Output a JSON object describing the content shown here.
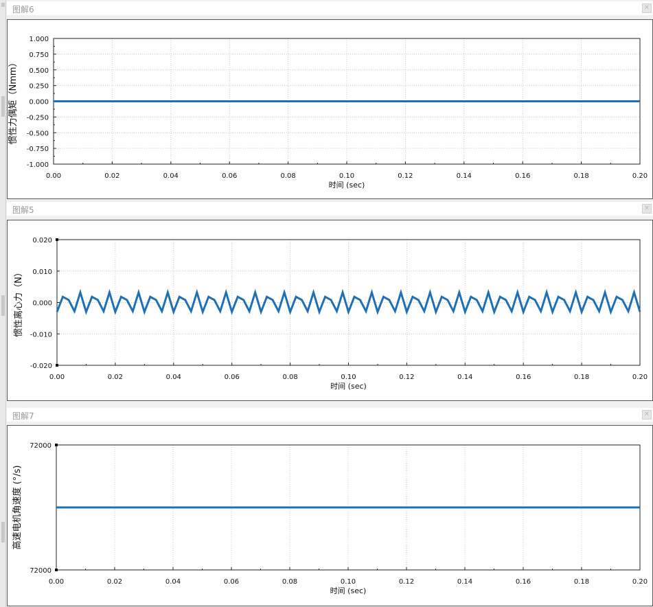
{
  "panels": [
    {
      "title": "图解6",
      "close_icon": "close-icon"
    },
    {
      "title": "图解5",
      "close_icon": "close-icon"
    },
    {
      "title": "图解7",
      "close_icon": "close-icon"
    }
  ],
  "chart_data": [
    {
      "type": "line",
      "title": "",
      "xlabel": "时间 (sec)",
      "ylabel": "惯性力偶矩（Nmm）",
      "xlim": [
        0,
        0.2
      ],
      "ylim": [
        -1.0,
        1.0
      ],
      "xticks": [
        "0.00",
        "0.02",
        "0.04",
        "0.06",
        "0.08",
        "0.10",
        "0.12",
        "0.14",
        "0.16",
        "0.18",
        "0.20"
      ],
      "yticks": [
        "1.000",
        "0.750",
        "0.500",
        "0.250",
        "0.000",
        "-0.250",
        "-0.500",
        "-0.750",
        "-1.000"
      ],
      "grid": true,
      "color": "#1f6fb5",
      "series": [
        {
          "x": [
            0,
            0.2
          ],
          "y": [
            0,
            0
          ]
        }
      ]
    },
    {
      "type": "line",
      "title": "",
      "xlabel": "时间 (sec)",
      "ylabel": "惯性离心力（N）",
      "xlim": [
        0,
        0.2
      ],
      "ylim": [
        -0.02,
        0.02
      ],
      "xticks": [
        "0.00",
        "0.02",
        "0.04",
        "0.06",
        "0.08",
        "0.10",
        "0.12",
        "0.14",
        "0.16",
        "0.18",
        "0.20"
      ],
      "yticks": [
        "0.020",
        "0.010",
        "0.000",
        "-0.010",
        "-0.020"
      ],
      "grid": true,
      "color": "#1f6fb5",
      "series": [
        {
          "x": [
            0,
            0.002,
            0.004,
            0.006,
            0.008,
            0.01,
            0.012,
            0.014,
            0.016,
            0.018,
            0.02,
            0.022,
            0.024,
            0.026,
            0.028,
            0.03,
            0.032,
            0.034,
            0.036,
            0.038,
            0.04,
            0.042,
            0.044,
            0.046,
            0.048,
            0.05,
            0.052,
            0.054,
            0.056,
            0.058,
            0.06,
            0.062,
            0.064,
            0.066,
            0.068,
            0.07,
            0.072,
            0.074,
            0.076,
            0.078,
            0.08,
            0.082,
            0.084,
            0.086,
            0.088,
            0.09,
            0.092,
            0.094,
            0.096,
            0.098,
            0.1,
            0.102,
            0.104,
            0.106,
            0.108,
            0.11,
            0.112,
            0.114,
            0.116,
            0.118,
            0.12,
            0.122,
            0.124,
            0.126,
            0.128,
            0.13,
            0.132,
            0.134,
            0.136,
            0.138,
            0.14,
            0.142,
            0.144,
            0.146,
            0.148,
            0.15,
            0.152,
            0.154,
            0.156,
            0.158,
            0.16,
            0.162,
            0.164,
            0.166,
            0.168,
            0.17,
            0.172,
            0.174,
            0.176,
            0.178,
            0.18,
            0.182,
            0.184,
            0.186,
            0.188,
            0.19,
            0.192,
            0.194,
            0.196,
            0.198,
            0.2
          ],
          "y": [
            -0.003,
            0.0018,
            0.0008,
            -0.0028,
            0.0032,
            -0.003,
            0.0018,
            0.0008,
            -0.0028,
            0.0032,
            -0.003,
            0.0018,
            0.0008,
            -0.0028,
            0.0032,
            -0.003,
            0.0018,
            0.0008,
            -0.0028,
            0.0032,
            -0.003,
            0.0018,
            0.0008,
            -0.0028,
            0.0032,
            -0.003,
            0.0018,
            0.0008,
            -0.0028,
            0.0032,
            -0.003,
            0.0018,
            0.0008,
            -0.0028,
            0.0032,
            -0.003,
            0.0018,
            0.0008,
            -0.0028,
            0.0032,
            -0.003,
            0.0018,
            0.0008,
            -0.0028,
            0.0032,
            -0.003,
            0.0018,
            0.0008,
            -0.0028,
            0.0032,
            -0.003,
            0.0018,
            0.0008,
            -0.0028,
            0.0032,
            -0.003,
            0.0018,
            0.0008,
            -0.0028,
            0.0032,
            -0.003,
            0.0018,
            0.0008,
            -0.0028,
            0.0032,
            -0.003,
            0.0018,
            0.0008,
            -0.0028,
            0.0032,
            -0.003,
            0.0018,
            0.0008,
            -0.0028,
            0.0032,
            -0.003,
            0.0018,
            0.0008,
            -0.0028,
            0.0032,
            -0.003,
            0.0018,
            0.0008,
            -0.0028,
            0.0032,
            -0.003,
            0.0018,
            0.0008,
            -0.0028,
            0.0032,
            -0.003,
            0.0018,
            0.0008,
            -0.0028,
            0.0032,
            -0.003,
            0.0018,
            0.0008,
            -0.0028,
            0.0032,
            -0.003
          ]
        }
      ]
    },
    {
      "type": "line",
      "title": "",
      "xlabel": "时间 (sec)",
      "ylabel": "高速电机角速度 (°/s)",
      "xlim": [
        0,
        0.2
      ],
      "ylim": [
        71999.99,
        72000.01
      ],
      "xticks": [
        "0.00",
        "0.02",
        "0.04",
        "0.06",
        "0.08",
        "0.10",
        "0.12",
        "0.14",
        "0.16",
        "0.18",
        "0.20"
      ],
      "yticks": [
        "72000",
        "72000"
      ],
      "grid": true,
      "color": "#1f6fb5",
      "series": [
        {
          "x": [
            0,
            0.2
          ],
          "y": [
            72000,
            72000
          ]
        }
      ]
    }
  ]
}
